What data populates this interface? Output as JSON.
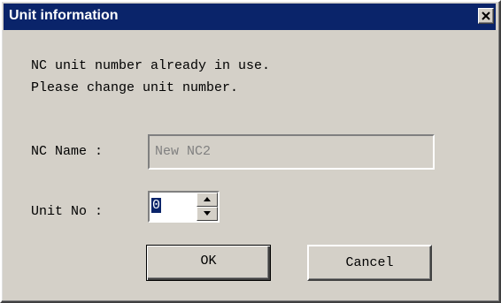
{
  "window": {
    "title": "Unit information",
    "close_icon": "close-icon"
  },
  "message": {
    "line1": "NC unit number already in use.",
    "line2": "Please change unit number."
  },
  "form": {
    "nc_name_label": "NC Name :",
    "nc_name_value": "New NC2",
    "unit_no_label": "Unit No :",
    "unit_no_value": "0"
  },
  "buttons": {
    "ok_label": "OK",
    "cancel_label": "Cancel"
  },
  "colors": {
    "titlebar": "#0a246a",
    "face": "#d4d0c8",
    "disabled_text": "#808080"
  }
}
